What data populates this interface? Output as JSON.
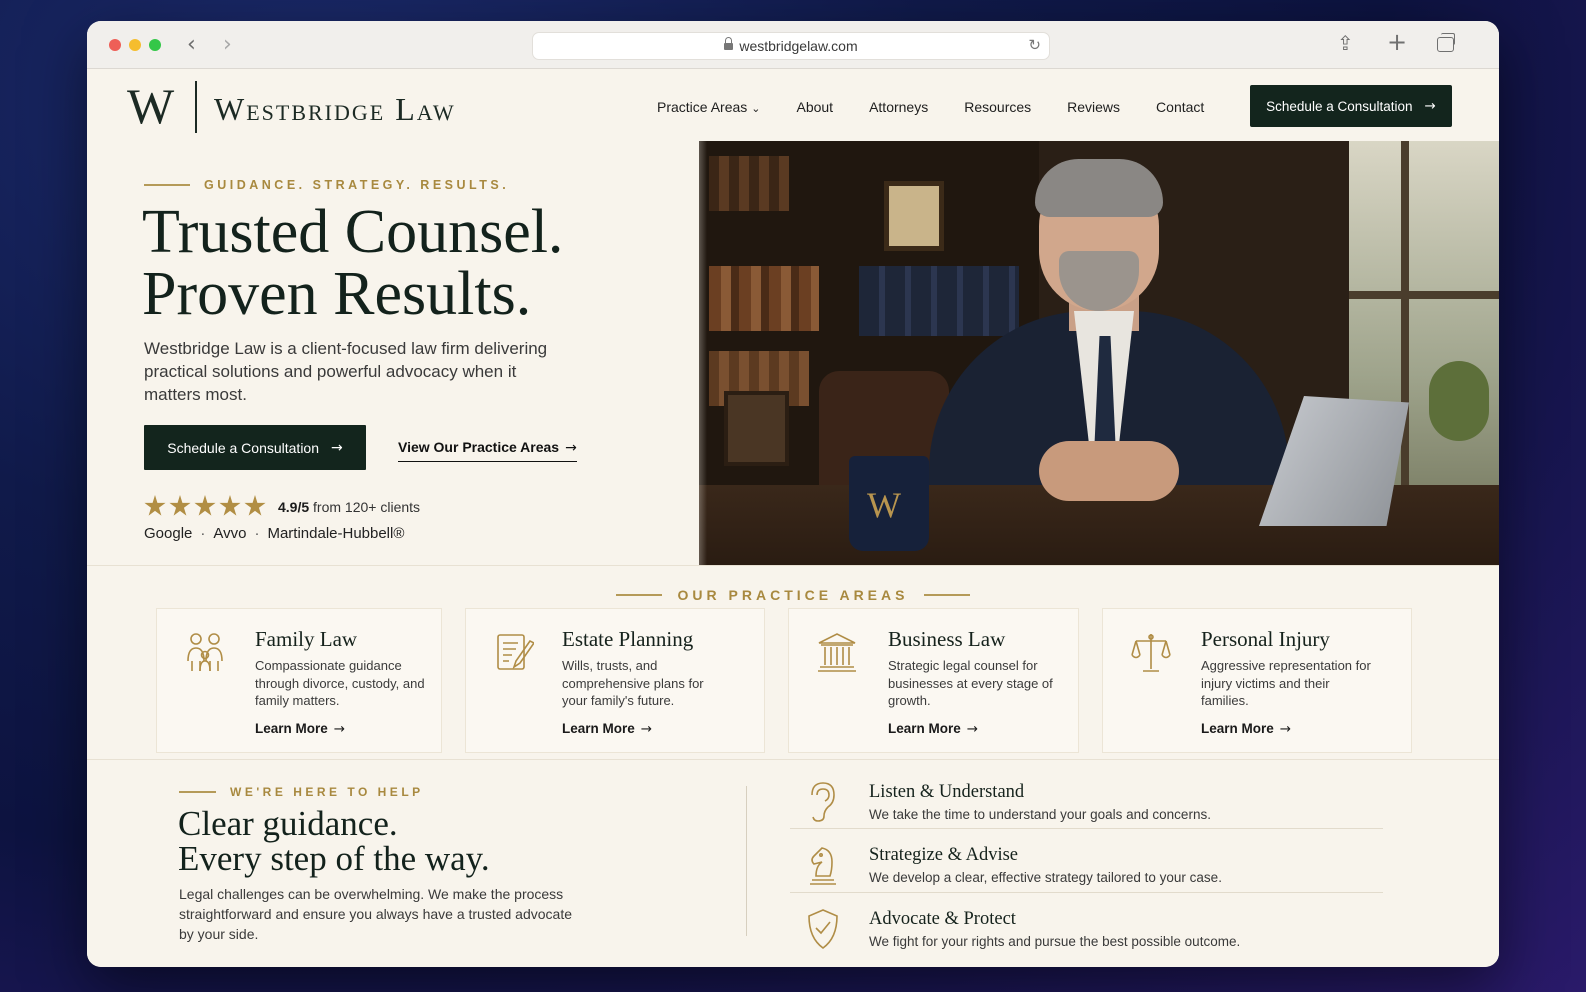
{
  "browser": {
    "url": "westbridgelaw.com"
  },
  "header": {
    "logo_mark": "W",
    "logo_text": "Westbridge Law",
    "nav": [
      "Practice Areas",
      "About",
      "Attorneys",
      "Resources",
      "Reviews",
      "Contact"
    ],
    "cta": "Schedule a Consultation"
  },
  "hero": {
    "eyebrow": "GUIDANCE. STRATEGY. RESULTS.",
    "title_line1": "Trusted Counsel.",
    "title_line2": "Proven Results.",
    "description": "Westbridge Law is a client-focused law firm delivering practical solutions and powerful advocacy when it matters most.",
    "cta_primary": "Schedule a Consultation",
    "cta_secondary": "View Our Practice Areas",
    "rating_value": "4.9/5",
    "rating_suffix": "from 120+ clients",
    "stars": 5,
    "sources": [
      "Google",
      "Avvo",
      "Martindale-Hubbell®"
    ],
    "mug_letter": "W"
  },
  "practice": {
    "label": "OUR PRACTICE AREAS",
    "link_label": "Learn More",
    "cards": [
      {
        "title": "Family Law",
        "desc": "Compassionate guidance through divorce, custody, and family matters.",
        "icon": "family-icon"
      },
      {
        "title": "Estate Planning",
        "desc": "Wills, trusts, and comprehensive plans for your family's future.",
        "icon": "document-pen-icon"
      },
      {
        "title": "Business Law",
        "desc": "Strategic legal counsel for businesses at every stage of growth.",
        "icon": "courthouse-icon"
      },
      {
        "title": "Personal Injury",
        "desc": "Aggressive representation for injury victims and their families.",
        "icon": "scales-icon"
      }
    ]
  },
  "help": {
    "eyebrow": "WE'RE HERE TO HELP",
    "title_line1": "Clear guidance.",
    "title_line2": "Every step of the way.",
    "description": "Legal challenges can be overwhelming. We make the process straightforward and ensure you always have a trusted advocate by your side.",
    "steps": [
      {
        "title": "Listen & Understand",
        "desc": "We take the time to understand your goals and concerns.",
        "icon": "ear-icon"
      },
      {
        "title": "Strategize & Advise",
        "desc": "We develop a clear, effective strategy tailored to your case.",
        "icon": "chess-knight-icon"
      },
      {
        "title": "Advocate & Protect",
        "desc": "We fight for your rights and pursue the best possible outcome.",
        "icon": "shield-check-icon"
      }
    ]
  },
  "colors": {
    "accent_gold": "#a8893f",
    "dark_green": "#13251d",
    "background": "#f8f4ec"
  }
}
